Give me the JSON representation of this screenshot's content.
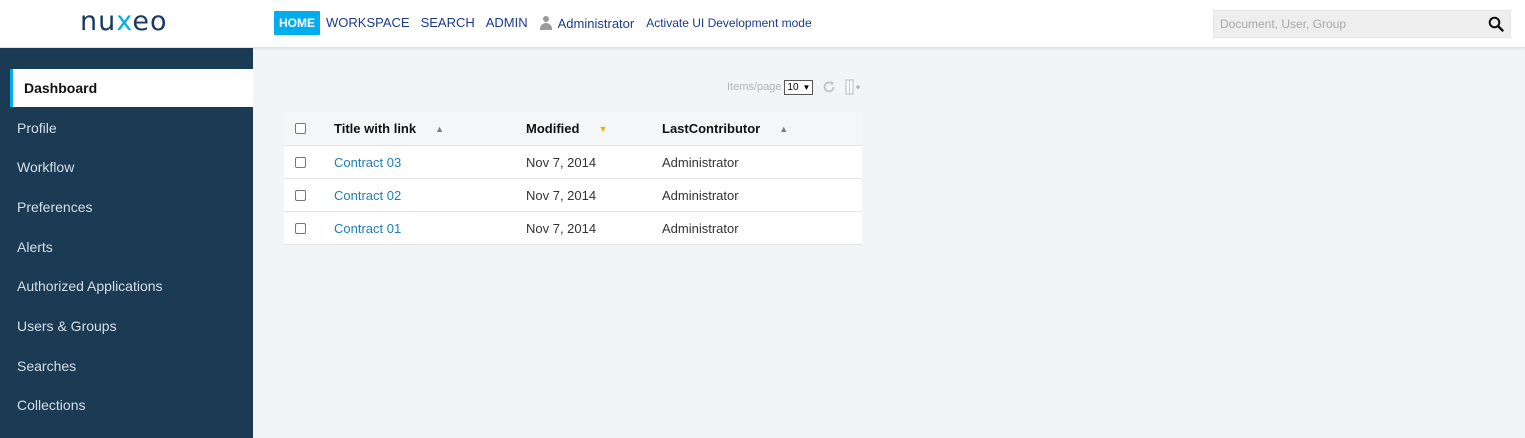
{
  "header": {
    "logo": {
      "pre": "nu",
      "x": "x",
      "post": "eo"
    },
    "nav": [
      "HOME",
      "WORKSPACE",
      "SEARCH",
      "ADMIN"
    ],
    "user": "Administrator",
    "dev_mode": "Activate UI Development mode",
    "search_placeholder": "Document, User, Group"
  },
  "sidebar": {
    "items": [
      "Dashboard",
      "Profile",
      "Workflow",
      "Preferences",
      "Alerts",
      "Authorized Applications",
      "Users & Groups",
      "Searches",
      "Collections"
    ]
  },
  "pager": {
    "label": "Items/page",
    "value": "10"
  },
  "table": {
    "headers": {
      "title": "Title with link",
      "modified": "Modified",
      "contributor": "LastContributor"
    },
    "sort_up": "▲",
    "sort_down": "▼",
    "rows": [
      {
        "title": "Contract 03",
        "modified": "Nov 7, 2014",
        "contributor": "Administrator"
      },
      {
        "title": "Contract 02",
        "modified": "Nov 7, 2014",
        "contributor": "Administrator"
      },
      {
        "title": "Contract 01",
        "modified": "Nov 7, 2014",
        "contributor": "Administrator"
      }
    ]
  },
  "colors": {
    "accent": "#00aeef",
    "sidebar_bg": "#1b3a53",
    "link": "#1f7fb6",
    "sort_active": "#f0b400"
  }
}
